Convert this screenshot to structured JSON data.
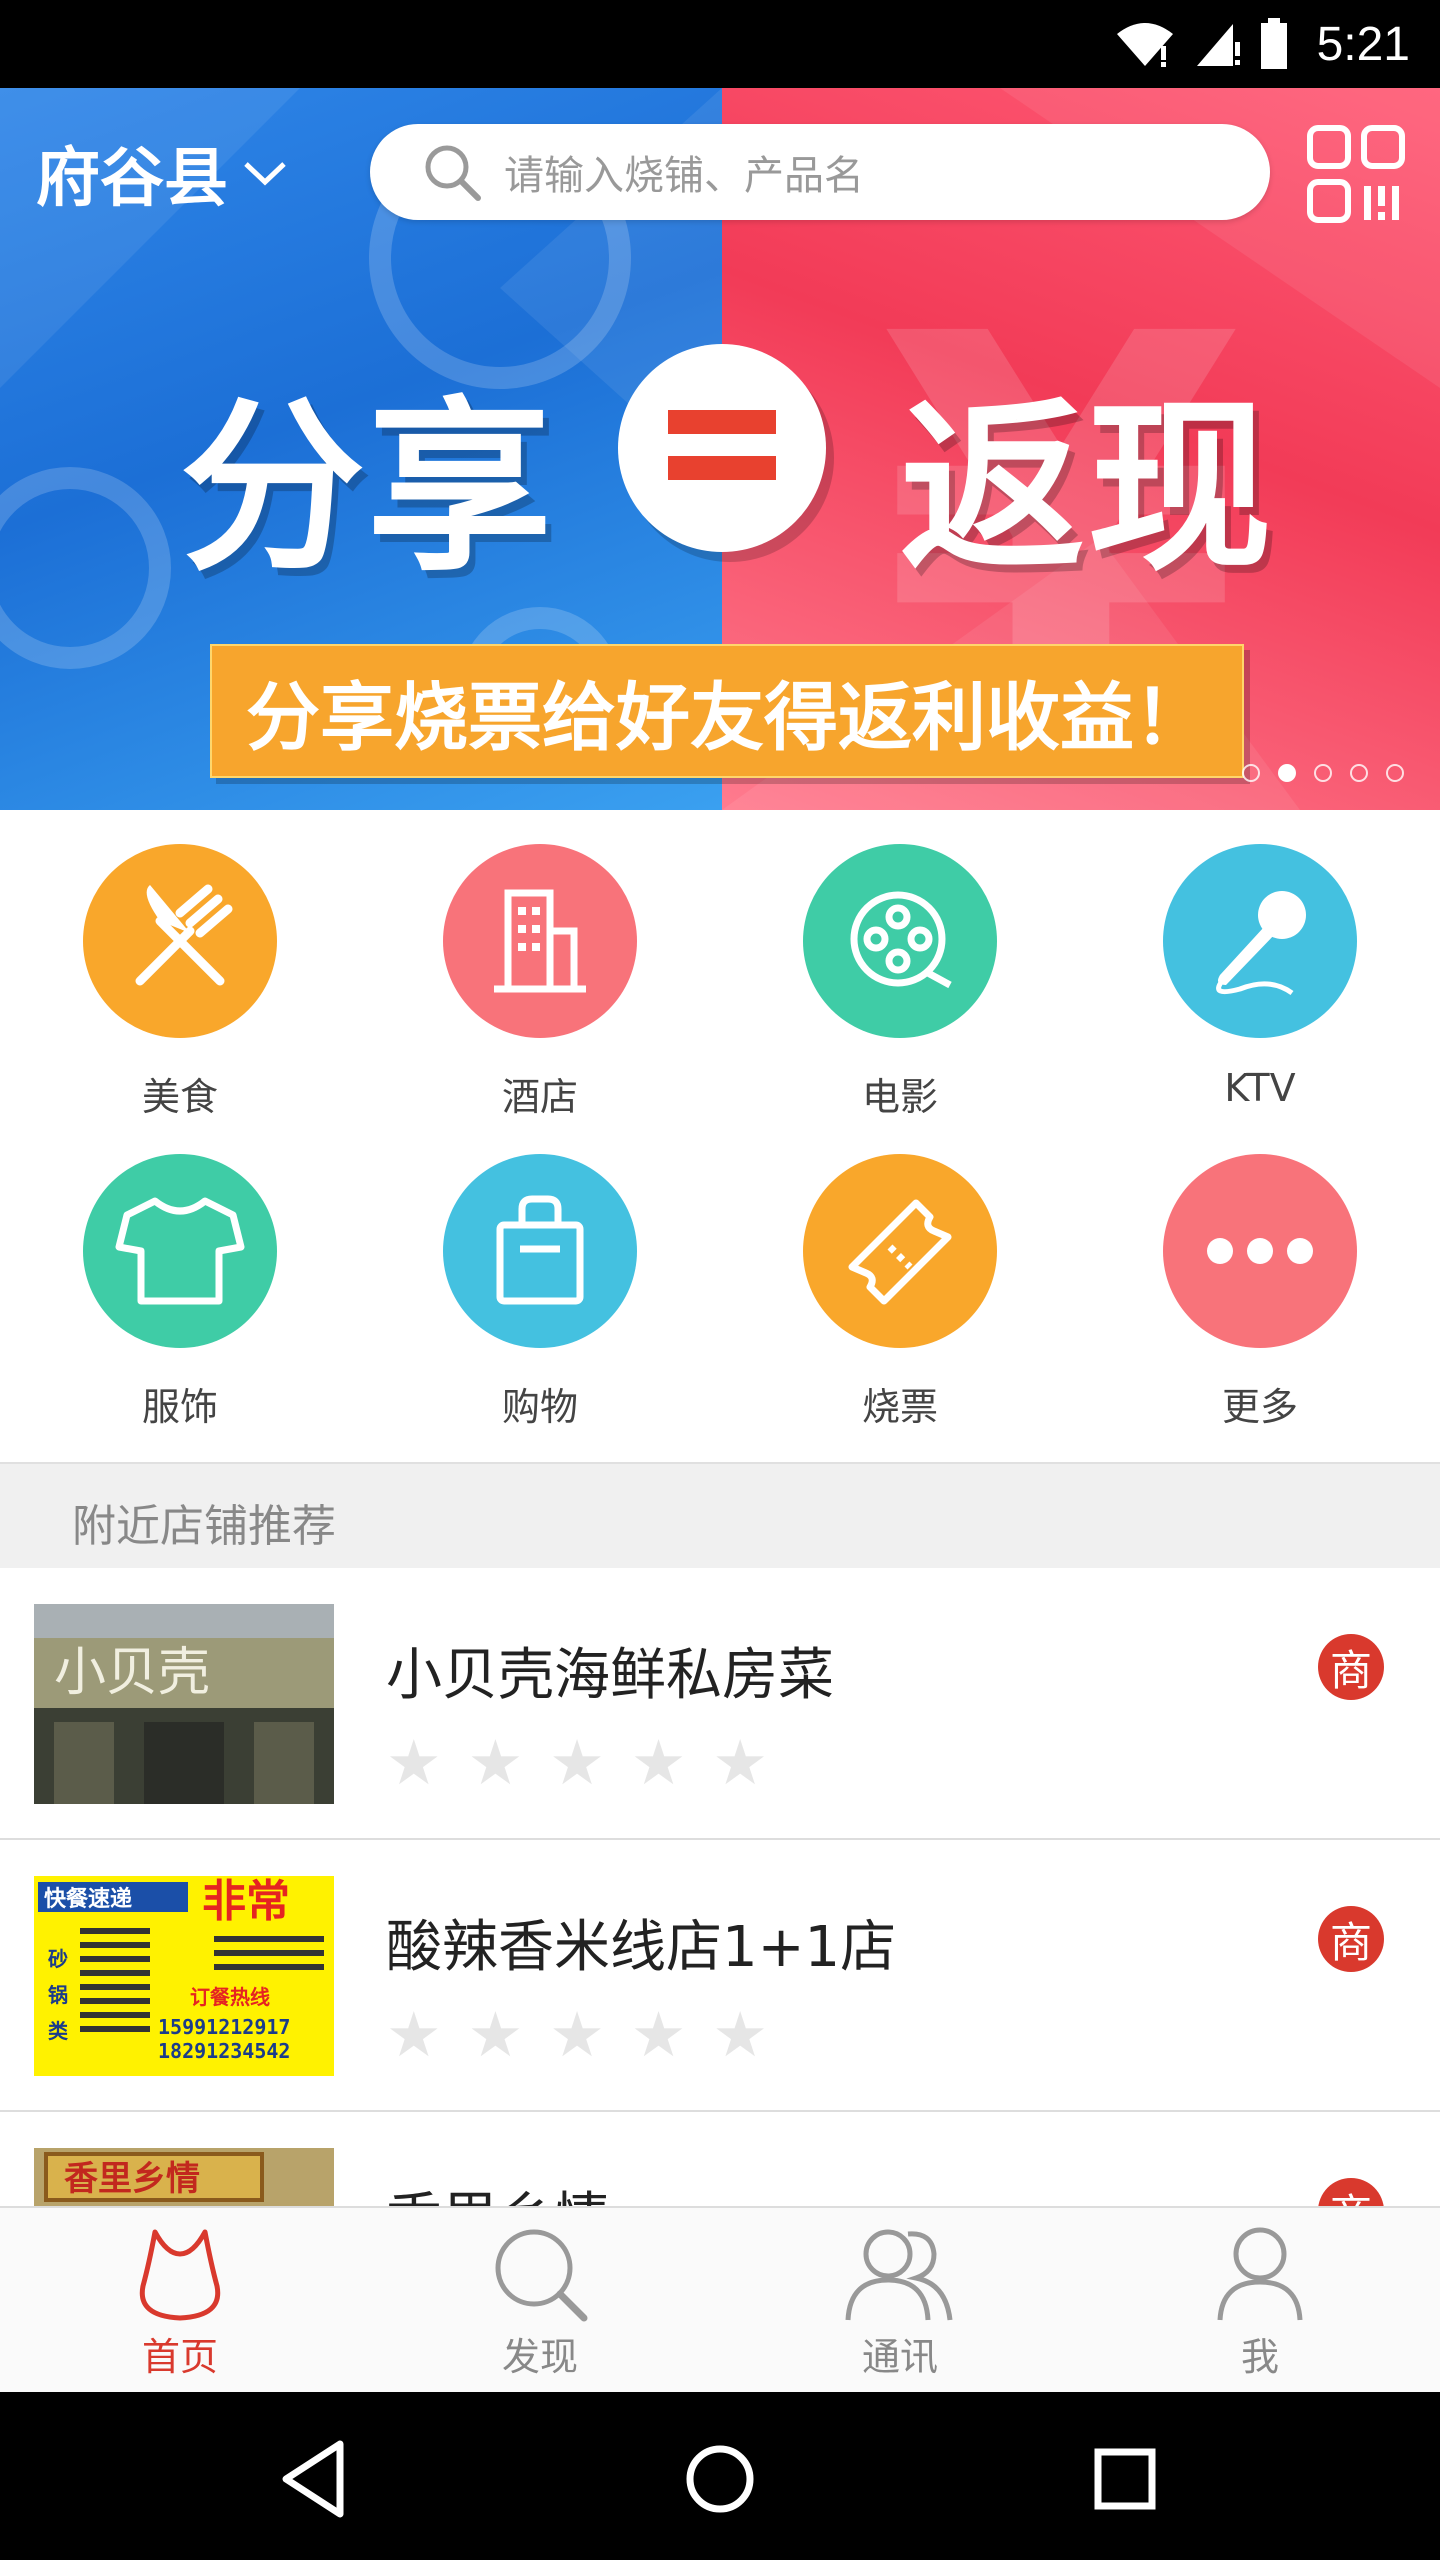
{
  "status_bar": {
    "time": "5:21"
  },
  "header": {
    "city": "府谷县",
    "search_placeholder": "请输入烧铺、产品名"
  },
  "banner": {
    "headline_left": "分享",
    "headline_right": "返现",
    "subtitle": "分享烧票给好友得返利收益！",
    "page_count": 5,
    "active_page": 2
  },
  "categories": [
    {
      "label": "美食",
      "icon": "fork-knife-icon",
      "color": "#f9a72b"
    },
    {
      "label": "酒店",
      "icon": "building-icon",
      "color": "#f8737a"
    },
    {
      "label": "电影",
      "icon": "film-reel-icon",
      "color": "#3fcca6"
    },
    {
      "label": "KTV",
      "icon": "microphone-icon",
      "color": "#44c1e0"
    },
    {
      "label": "服饰",
      "icon": "tshirt-icon",
      "color": "#3fcca6"
    },
    {
      "label": "购物",
      "icon": "shopping-bag-icon",
      "color": "#44c1e0"
    },
    {
      "label": "烧票",
      "icon": "ticket-icon",
      "color": "#f9a72b"
    },
    {
      "label": "更多",
      "icon": "more-dots-icon",
      "color": "#f8737a"
    }
  ],
  "section": {
    "title": "附近店铺推荐"
  },
  "stores": [
    {
      "name": "小贝壳海鲜私房菜",
      "badge": "商",
      "rating": 0
    },
    {
      "name": "酸辣香米线店1+1店",
      "badge": "商",
      "rating": 0
    },
    {
      "name": "香里乡情",
      "badge": "商",
      "rating": 0
    }
  ],
  "store_thumbs": {
    "store1_sign": "小贝壳",
    "store2_sign_left": "快餐速递",
    "store2_sign_right": "非常",
    "store2_phone1": "15991212917",
    "store2_phone2": "18291234542",
    "store2_hotline": "订餐热线",
    "store3_sign": "香里乡情"
  },
  "bottom_nav": [
    {
      "label": "首页",
      "icon": "home-vase-icon",
      "active": true
    },
    {
      "label": "发现",
      "icon": "discover-search-icon",
      "active": false
    },
    {
      "label": "通讯",
      "icon": "contacts-icon",
      "active": false
    },
    {
      "label": "我",
      "icon": "profile-icon",
      "active": false
    }
  ],
  "colors": {
    "accent": "#d9392d"
  }
}
